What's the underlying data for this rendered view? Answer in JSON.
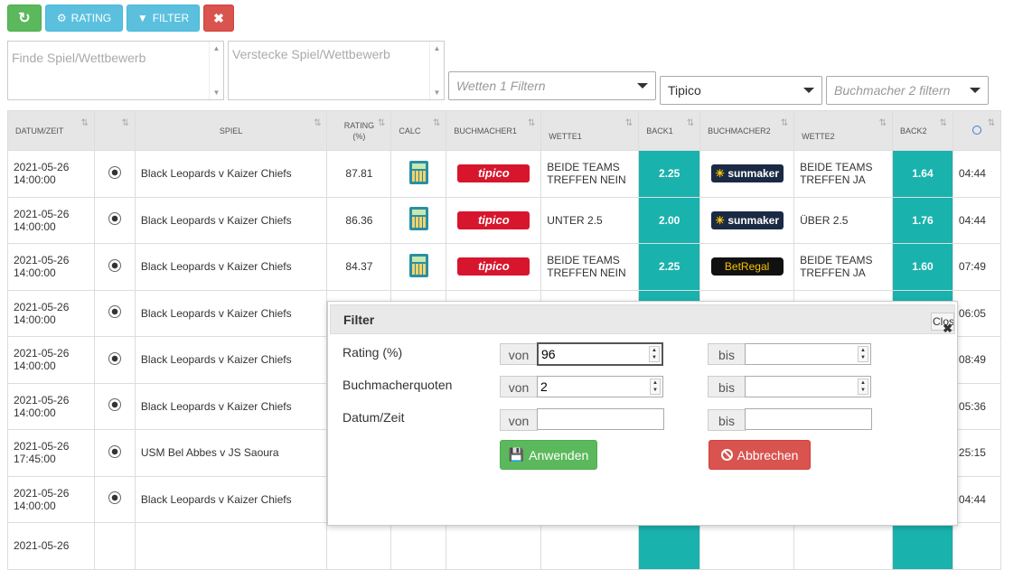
{
  "toolbar": {
    "refresh_icon": "refresh-icon",
    "rating_label": "RATING",
    "filter_label": "FILTER",
    "clear_icon": "times-icon",
    "colors": {
      "green": "#5cb85c",
      "info": "#5bc0de",
      "red": "#d9534f"
    }
  },
  "search": {
    "find_placeholder": "Finde Spiel/Wettbewerb",
    "hide_placeholder": "Verstecke Spiel/Wettbewerb"
  },
  "filters": {
    "wetten_placeholder": "Wetten 1 Filtern",
    "bookmaker1_value": "Tipico",
    "bookmaker2_placeholder": "Buchmacher 2 filtern"
  },
  "table": {
    "headers": [
      "DATUM/ZEIT",
      "",
      "SPIEL",
      "RATING (%)",
      "CALC",
      "BUCHMACHER1",
      "WETTE1",
      "BACK1",
      "BUCHMACHER2",
      "WETTE2",
      "BACK2",
      ""
    ],
    "back_color": "#1ab2ad",
    "rows": [
      {
        "date": "2021-05-26",
        "time": "14:00:00",
        "game": "Black Leopards v Kaizer Chiefs",
        "rating": "87.81",
        "bm1": "tipico",
        "bet1a": "BEIDE TEAMS",
        "bet1b": "TREFFEN NEIN",
        "back1": "2.25",
        "bm2": "sunmaker",
        "bet2a": "BEIDE TEAMS",
        "bet2b": "TREFFEN JA",
        "back2": "1.64",
        "clock": "04:44"
      },
      {
        "date": "2021-05-26",
        "time": "14:00:00",
        "game": "Black Leopards v Kaizer Chiefs",
        "rating": "86.36",
        "bm1": "tipico",
        "bet1a": "UNTER 2.5",
        "bet1b": "",
        "back1": "2.00",
        "bm2": "sunmaker",
        "bet2a": "ÜBER 2.5",
        "bet2b": "",
        "back2": "1.76",
        "clock": "04:44"
      },
      {
        "date": "2021-05-26",
        "time": "14:00:00",
        "game": "Black Leopards v Kaizer Chiefs",
        "rating": "84.37",
        "bm1": "tipico",
        "bet1a": "BEIDE TEAMS",
        "bet1b": "TREFFEN NEIN",
        "back1": "2.25",
        "bm2": "BetRegal",
        "bet2a": "BEIDE TEAMS",
        "bet2b": "TREFFEN JA",
        "back2": "1.60",
        "clock": "07:49"
      },
      {
        "date": "2021-05-26",
        "time": "14:00:00",
        "game": "Black Leopards v Kaizer Chiefs",
        "clock": "06:05"
      },
      {
        "date": "2021-05-26",
        "time": "14:00:00",
        "game": "Black Leopards v Kaizer Chiefs",
        "clock": "08:49"
      },
      {
        "date": "2021-05-26",
        "time": "14:00:00",
        "game": "Black Leopards v Kaizer Chiefs",
        "clock": "05:36"
      },
      {
        "date": "2021-05-26",
        "time": "17:45:00",
        "game": "USM Bel Abbes v JS Saoura",
        "clock": "25:15"
      },
      {
        "date": "2021-05-26",
        "time": "14:00:00",
        "game": "Black Leopards v Kaizer Chiefs",
        "clock": "04:44"
      },
      {
        "date": "2021-05-26",
        "time": "",
        "game": "",
        "clock": ""
      }
    ]
  },
  "modal": {
    "title": "Filter",
    "close_label": "Close",
    "rating_label": "Rating (%)",
    "odds_label": "Buchmacherquoten",
    "date_label": "Datum/Zeit",
    "von": "von",
    "bis": "bis",
    "rating_from": "96",
    "rating_to": "",
    "odds_from": "2",
    "odds_to": "",
    "date_from": "",
    "date_to": "",
    "apply_label": "Anwenden",
    "cancel_label": "Abbrechen",
    "apply_color": "#5cb85c",
    "cancel_color": "#d9534f"
  }
}
